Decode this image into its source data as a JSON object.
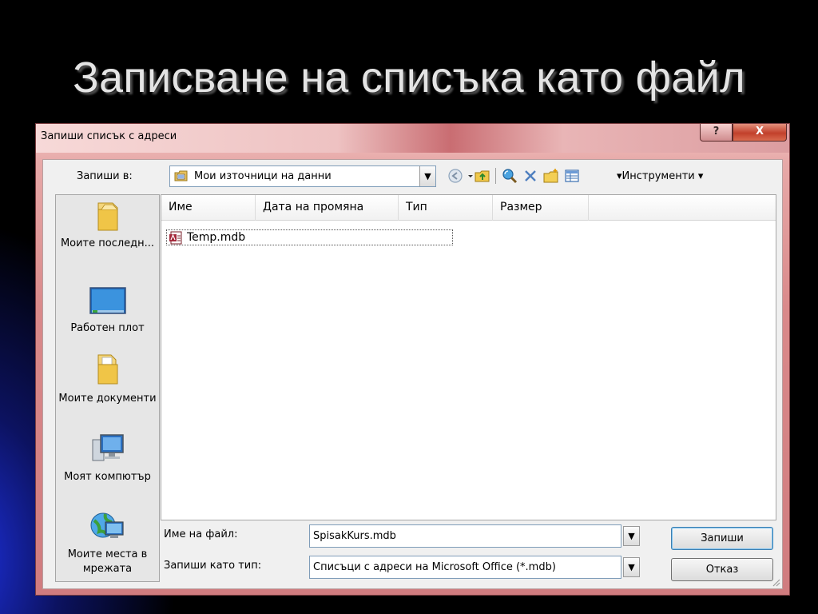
{
  "slide": {
    "title": "Записване на списъка като файл"
  },
  "dialog": {
    "title": "Запиши списък с адреси",
    "help_label": "?",
    "close_label": "X",
    "save_in_label": "Запиши в:",
    "location": "Мои източници на данни",
    "tools_label": "▾Инструменти ▾",
    "places": [
      {
        "label": "Моите последн...",
        "icon": "recent-folder-icon"
      },
      {
        "label": "Работен плот",
        "icon": "desktop-icon"
      },
      {
        "label": "Моите документи",
        "icon": "documents-folder-icon"
      },
      {
        "label": "Моят компютър",
        "icon": "computer-icon"
      },
      {
        "label": "Моите места в мрежата",
        "icon": "network-places-icon"
      }
    ],
    "columns": [
      "Име",
      "Дата на промяна",
      "Тип",
      "Размер"
    ],
    "files": [
      {
        "name": "Temp.mdb",
        "icon": "access-database-icon"
      }
    ],
    "filename_label": "Име на файл:",
    "filename_value": "SpisakKurs.mdb",
    "filetype_label": "Запиши като тип:",
    "filetype_value": "Списъци с адреси на Microsoft Office (*.mdb)",
    "save_button": "Запиши",
    "cancel_button": "Отказ"
  },
  "colors": {
    "frame": "#d9898a",
    "close_button": "#c2402b",
    "client": "#f0f0f0"
  }
}
